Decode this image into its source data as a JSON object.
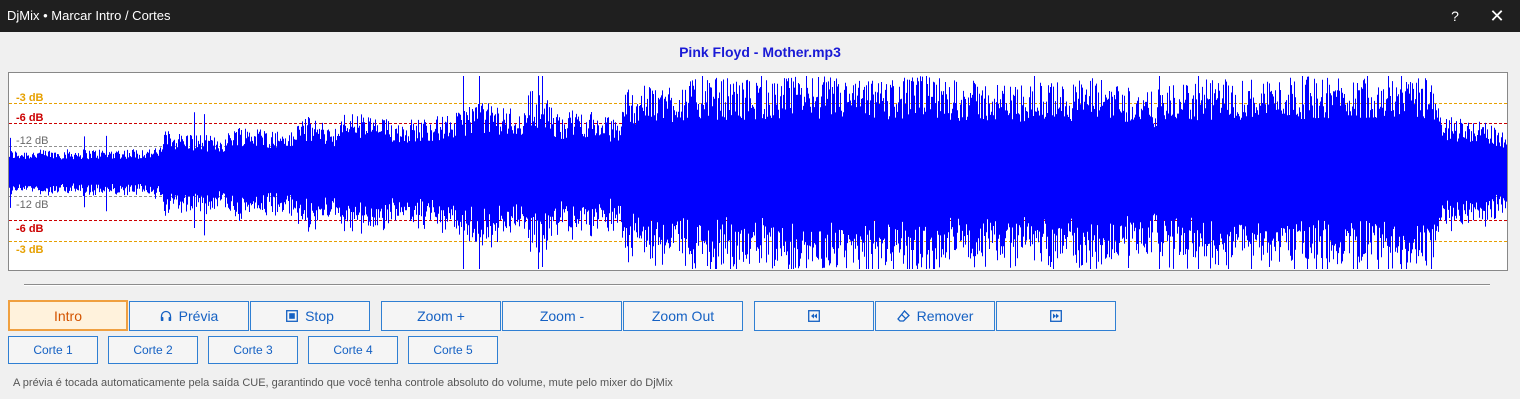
{
  "window": {
    "title": "DjMix • Marcar Intro / Cortes",
    "help_glyph": "?",
    "close_glyph": "✕"
  },
  "track": {
    "filename": "Pink Floyd - Mother.mp3"
  },
  "waveform": {
    "color": "#0000ff",
    "db_labels": {
      "top": [
        "-3 dB",
        "-6 dB",
        "-12 dB"
      ],
      "bottom": [
        "-12 dB",
        "-6 dB",
        "-3 dB"
      ]
    },
    "db_colors": {
      "minus3": "#e6a000",
      "minus6": "#cc0000",
      "minus12": "#707070"
    }
  },
  "buttons": {
    "intro": "Intro",
    "previa": "Prévia",
    "stop": "Stop",
    "zoom_in": "Zoom +",
    "zoom_out_step": "Zoom -",
    "zoom_reset": "Zoom Out",
    "remover": "Remover",
    "cortes": [
      "Corte 1",
      "Corte 2",
      "Corte 3",
      "Corte 4",
      "Corte 5"
    ]
  },
  "icons": {
    "previa": "headphones-icon",
    "stop": "stop-icon",
    "prev": "previous-marker-icon",
    "remover": "eraser-icon",
    "next": "next-marker-icon"
  },
  "footer": {
    "note": "A prévia é tocada automaticamente pela saída CUE, garantindo que você tenha controle absoluto do volume, mute  pelo mixer do DjMix"
  }
}
